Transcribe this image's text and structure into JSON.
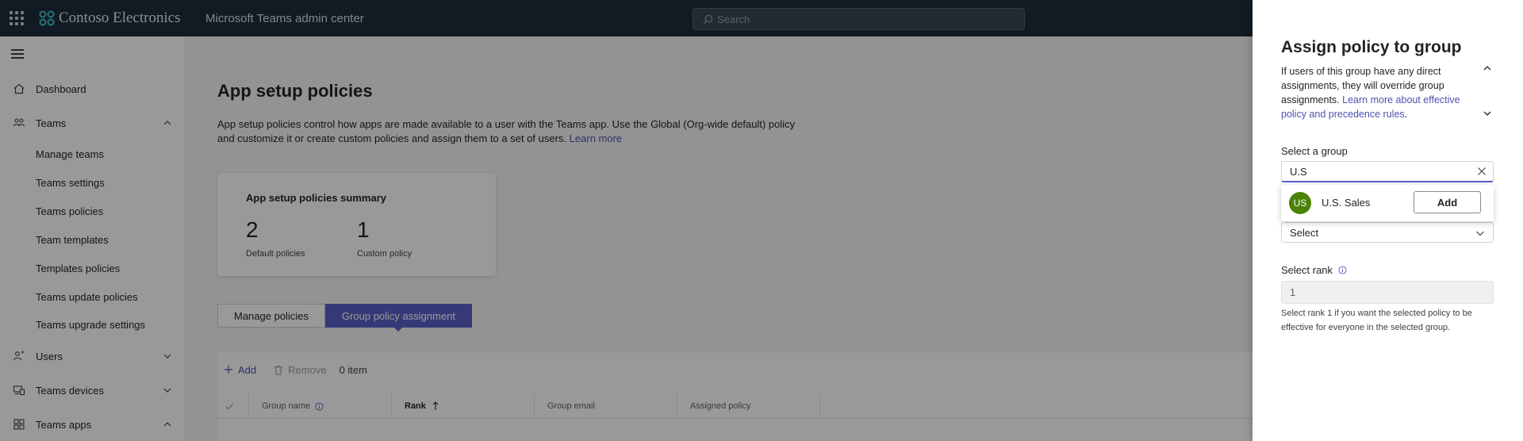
{
  "topbar": {
    "brand": "Contoso Electronics",
    "product": "Microsoft Teams admin center",
    "search_placeholder": "Search"
  },
  "sidebar": {
    "items": [
      {
        "label": "Dashboard",
        "icon": "home-icon"
      },
      {
        "label": "Teams",
        "icon": "teams-icon",
        "expanded": true
      },
      {
        "label": "Users",
        "icon": "users-icon",
        "expanded": false
      },
      {
        "label": "Teams devices",
        "icon": "devices-icon",
        "expanded": false
      },
      {
        "label": "Teams apps",
        "icon": "apps-icon",
        "expanded": true
      }
    ],
    "teams_subitems": [
      "Manage teams",
      "Teams settings",
      "Teams policies",
      "Team templates",
      "Templates policies",
      "Teams update policies",
      "Teams upgrade settings"
    ]
  },
  "main": {
    "title": "App setup policies",
    "description": "App setup policies control how apps are made available to a user with the Teams app. Use the Global (Org-wide default) policy and customize it or create custom policies and assign them to a set of users.",
    "learn_more": "Learn more",
    "summary": {
      "title": "App setup policies summary",
      "stats": [
        {
          "value": "2",
          "label": "Default policies"
        },
        {
          "value": "1",
          "label": "Custom policy"
        }
      ]
    },
    "tabs": [
      {
        "label": "Manage policies",
        "active": false
      },
      {
        "label": "Group policy assignment",
        "active": true
      }
    ],
    "toolbar": {
      "add": "Add",
      "remove": "Remove",
      "count": "0 item"
    },
    "columns": [
      "Group name",
      "Rank",
      "Group email",
      "Assigned policy"
    ]
  },
  "panel": {
    "title": "Assign policy to group",
    "info": "If users of this group have any direct assignments, they will override group assignments.",
    "info_link": "Learn more about effective policy and precedence rules",
    "select_group_label": "Select a group",
    "group_query": "U.S",
    "suggestion": {
      "initials": "US",
      "name": "U.S. Sales",
      "add_label": "Add",
      "avatar_color": "#498205"
    },
    "policy_select_value": "Select",
    "rank_label": "Select rank",
    "rank_value": "1",
    "rank_hint": "Select rank 1 if you want the selected policy to be effective for everyone in the selected group."
  },
  "colors": {
    "accent": "#5b5fc7",
    "topbar": "#1f2c3c",
    "link": "#4f52b2"
  }
}
